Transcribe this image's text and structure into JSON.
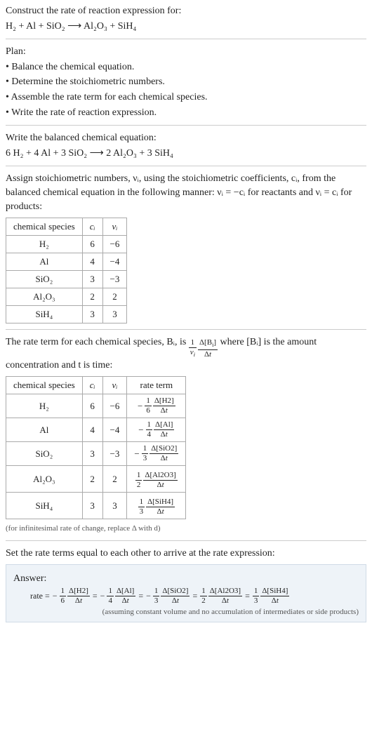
{
  "header": {
    "prompt": "Construct the rate of reaction expression for:",
    "reaction": "H₂ + Al + SiO₂ ⟶ Al₂O₃ + SiH₄"
  },
  "plan": {
    "title": "Plan:",
    "items": [
      "Balance the chemical equation.",
      "Determine the stoichiometric numbers.",
      "Assemble the rate term for each chemical species.",
      "Write the rate of reaction expression."
    ]
  },
  "balanced": {
    "title": "Write the balanced chemical equation:",
    "equation": "6 H₂ + 4 Al + 3 SiO₂ ⟶ 2 Al₂O₃ + 3 SiH₄"
  },
  "stoich": {
    "intro": "Assign stoichiometric numbers, νᵢ, using the stoichiometric coefficients, cᵢ, from the balanced chemical equation in the following manner: νᵢ = −cᵢ for reactants and νᵢ = cᵢ for products:",
    "headers": [
      "chemical species",
      "cᵢ",
      "νᵢ"
    ],
    "rows": [
      {
        "species": "H₂",
        "c": "6",
        "v": "−6"
      },
      {
        "species": "Al",
        "c": "4",
        "v": "−4"
      },
      {
        "species": "SiO₂",
        "c": "3",
        "v": "−3"
      },
      {
        "species": "Al₂O₃",
        "c": "2",
        "v": "2"
      },
      {
        "species": "SiH₄",
        "c": "3",
        "v": "3"
      }
    ]
  },
  "rate_terms": {
    "intro1": "The rate term for each chemical species, Bᵢ, is",
    "intro2": "where [Bᵢ] is the amount concentration and t is time:",
    "headers": [
      "chemical species",
      "cᵢ",
      "νᵢ",
      "rate term"
    ],
    "rows": [
      {
        "species": "H₂",
        "c": "6",
        "v": "−6",
        "sign": "−",
        "coef_n": "1",
        "coef_d": "6",
        "delta": "Δ[H2]"
      },
      {
        "species": "Al",
        "c": "4",
        "v": "−4",
        "sign": "−",
        "coef_n": "1",
        "coef_d": "4",
        "delta": "Δ[Al]"
      },
      {
        "species": "SiO₂",
        "c": "3",
        "v": "−3",
        "sign": "−",
        "coef_n": "1",
        "coef_d": "3",
        "delta": "Δ[SiO2]"
      },
      {
        "species": "Al₂O₃",
        "c": "2",
        "v": "2",
        "sign": "",
        "coef_n": "1",
        "coef_d": "2",
        "delta": "Δ[Al2O3]"
      },
      {
        "species": "SiH₄",
        "c": "3",
        "v": "3",
        "sign": "",
        "coef_n": "1",
        "coef_d": "3",
        "delta": "Δ[SiH4]"
      }
    ],
    "note": "(for infinitesimal rate of change, replace Δ with d)"
  },
  "final": {
    "intro": "Set the rate terms equal to each other to arrive at the rate expression:",
    "answer_label": "Answer:",
    "rate_label": "rate =",
    "terms": [
      {
        "sign": "−",
        "coef_n": "1",
        "coef_d": "6",
        "delta": "Δ[H2]"
      },
      {
        "sign": "−",
        "coef_n": "1",
        "coef_d": "4",
        "delta": "Δ[Al]"
      },
      {
        "sign": "−",
        "coef_n": "1",
        "coef_d": "3",
        "delta": "Δ[SiO2]"
      },
      {
        "sign": "",
        "coef_n": "1",
        "coef_d": "2",
        "delta": "Δ[Al2O3]"
      },
      {
        "sign": "",
        "coef_n": "1",
        "coef_d": "3",
        "delta": "Δ[SiH4]"
      }
    ],
    "note": "(assuming constant volume and no accumulation of intermediates or side products)"
  },
  "chart_data": {
    "type": "table",
    "tables": [
      {
        "title": "stoichiometric numbers",
        "columns": [
          "chemical species",
          "c_i",
          "ν_i"
        ],
        "rows": [
          [
            "H2",
            6,
            -6
          ],
          [
            "Al",
            4,
            -4
          ],
          [
            "SiO2",
            3,
            -3
          ],
          [
            "Al2O3",
            2,
            2
          ],
          [
            "SiH4",
            3,
            3
          ]
        ]
      },
      {
        "title": "rate terms",
        "columns": [
          "chemical species",
          "c_i",
          "ν_i",
          "rate term"
        ],
        "rows": [
          [
            "H2",
            6,
            -6,
            "-(1/6) Δ[H2]/Δt"
          ],
          [
            "Al",
            4,
            -4,
            "-(1/4) Δ[Al]/Δt"
          ],
          [
            "SiO2",
            3,
            -3,
            "-(1/3) Δ[SiO2]/Δt"
          ],
          [
            "Al2O3",
            2,
            2,
            "(1/2) Δ[Al2O3]/Δt"
          ],
          [
            "SiH4",
            3,
            3,
            "(1/3) Δ[SiH4]/Δt"
          ]
        ]
      }
    ],
    "rate_expression": "rate = -(1/6) Δ[H2]/Δt = -(1/4) Δ[Al]/Δt = -(1/3) Δ[SiO2]/Δt = (1/2) Δ[Al2O3]/Δt = (1/3) Δ[SiH4]/Δt"
  }
}
